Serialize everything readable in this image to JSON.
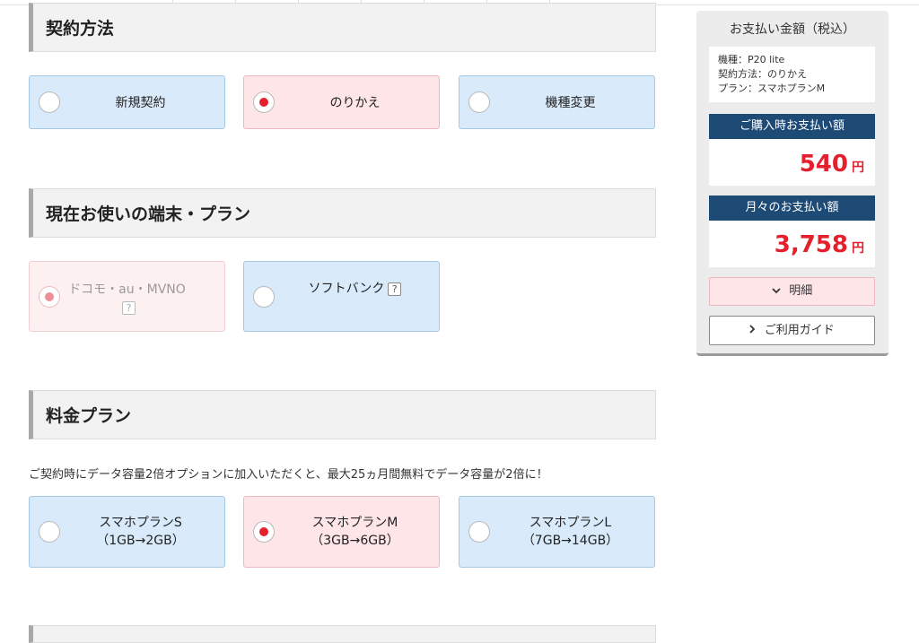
{
  "contract": {
    "header": "契約方法",
    "options": [
      {
        "label": "新規契約",
        "selected": false
      },
      {
        "label": "のりかえ",
        "selected": true
      },
      {
        "label": "機種変更",
        "selected": false
      }
    ]
  },
  "current_device": {
    "header": "現在お使いの端末・プラン",
    "options": [
      {
        "label": "ドコモ・au・MVNO",
        "help": "?",
        "selected": true,
        "disabled": true
      },
      {
        "label": "ソフトバンク",
        "help": "?",
        "selected": false
      }
    ]
  },
  "plan": {
    "header": "料金プラン",
    "note": "ご契約時にデータ容量2倍オプションに加入いただくと、最大25ヵ月間無料でデータ容量が2倍に！",
    "options": [
      {
        "line1": "スマホプランS",
        "line2": "（1GB→2GB）",
        "selected": false
      },
      {
        "line1": "スマホプランM",
        "line2": "（3GB→6GB）",
        "selected": true
      },
      {
        "line1": "スマホプランL",
        "line2": "（7GB→14GB）",
        "selected": false
      }
    ]
  },
  "summary": {
    "title": "お支払い金額（税込）",
    "info": [
      "機種：P20 lite",
      "契約方法：のりかえ",
      "プラン：スマホプランM"
    ],
    "purchase": {
      "label": "ご購入時お支払い額",
      "amount": "540",
      "unit": "円"
    },
    "monthly": {
      "label": "月々のお支払い額",
      "amount": "3,758",
      "unit": "円"
    },
    "detail_button": "明細",
    "guide_button": "ご利用ガイド"
  },
  "colors": {
    "accent_red": "#e5202e",
    "navy": "#1e4a76",
    "selected_bg": "#fde5e8",
    "option_bg": "#d9ebfb"
  },
  "icons": {
    "detail": "chevron-down-icon",
    "guide": "chevron-right-icon"
  }
}
